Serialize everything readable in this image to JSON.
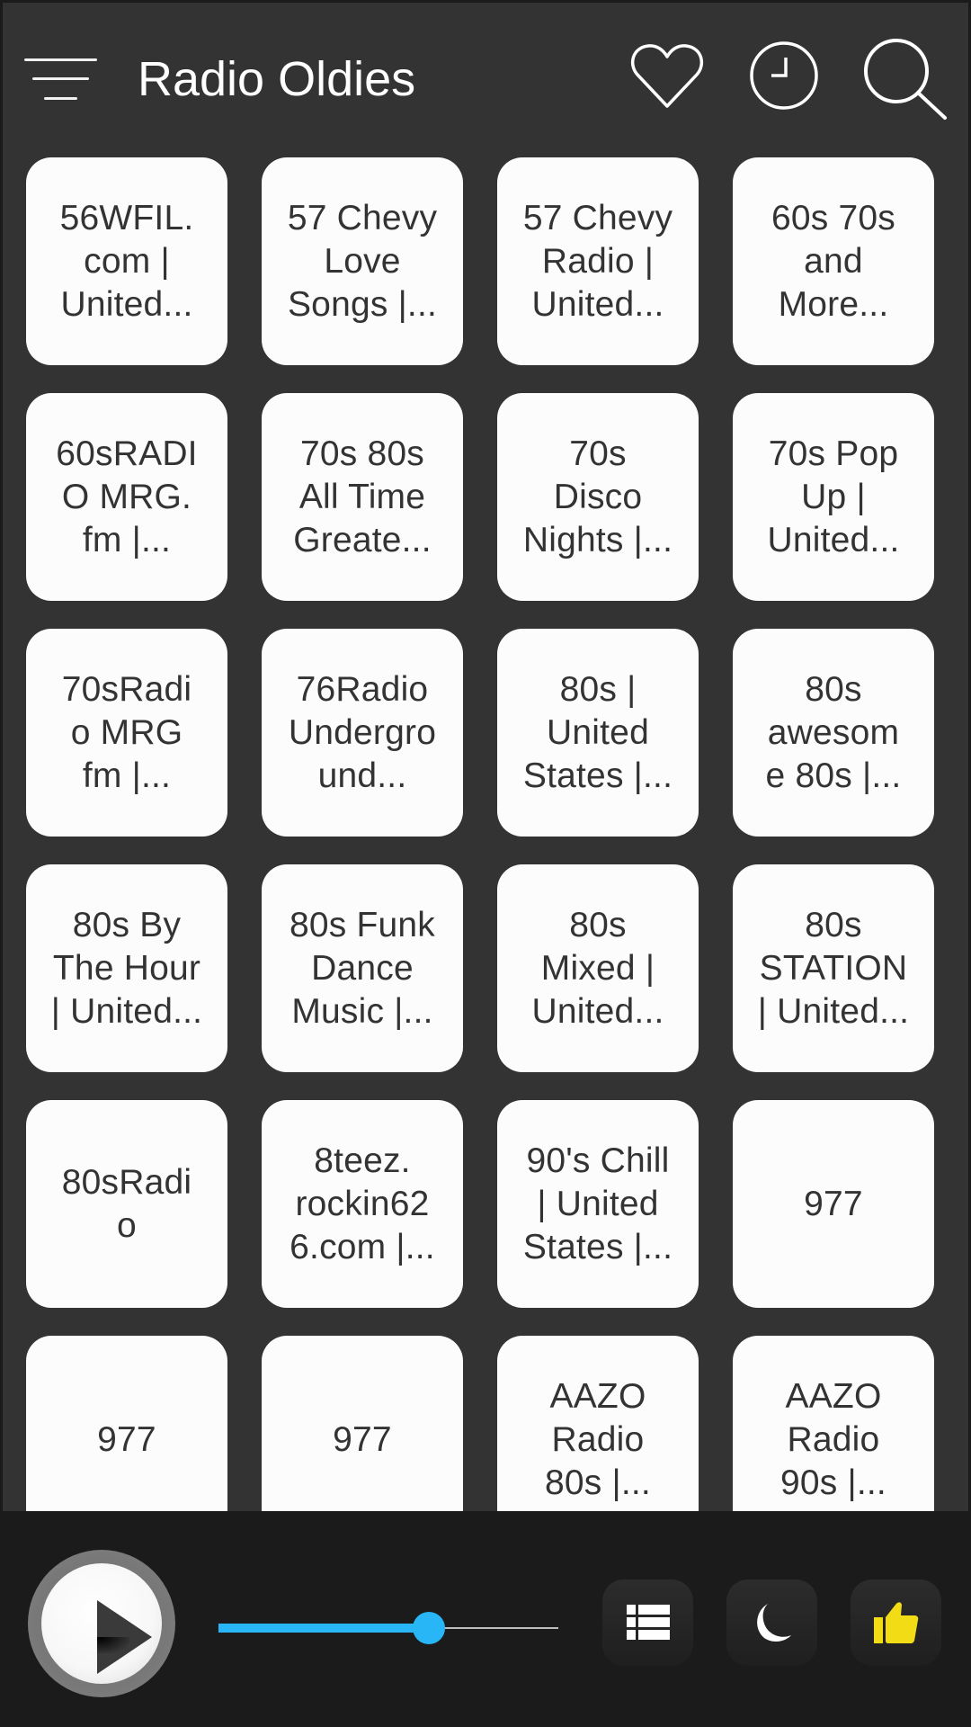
{
  "header": {
    "title": "Radio Oldies",
    "icons": [
      "menu-icon",
      "heart-icon",
      "clock-icon",
      "search-icon"
    ]
  },
  "stations": [
    {
      "label": "56WFIL.\ncom |\nUnited..."
    },
    {
      "label": "57 Chevy\nLove\nSongs |..."
    },
    {
      "label": "57 Chevy\nRadio |\nUnited..."
    },
    {
      "label": "60s 70s\nand\nMore..."
    },
    {
      "label": "60sRADI\nO MRG.\nfm |..."
    },
    {
      "label": "70s 80s\nAll Time\nGreate..."
    },
    {
      "label": "70s\nDisco\nNights |..."
    },
    {
      "label": "70s Pop\nUp |\nUnited..."
    },
    {
      "label": "70sRadi\no MRG\nfm |..."
    },
    {
      "label": "76Radio\nUndergro\nund..."
    },
    {
      "label": "80s |\nUnited\nStates |..."
    },
    {
      "label": "80s\nawesom\ne 80s |..."
    },
    {
      "label": "80s By\nThe Hour\n| United..."
    },
    {
      "label": "80s Funk\nDance\nMusic |..."
    },
    {
      "label": "80s\nMixed |\nUnited..."
    },
    {
      "label": "80s\nSTATION\n| United..."
    },
    {
      "label": "80sRadi\no"
    },
    {
      "label": "8teez.\nrockin62\n6.com |..."
    },
    {
      "label": "90's Chill\n| United\nStates |..."
    },
    {
      "label": "977"
    },
    {
      "label": "977"
    },
    {
      "label": "977"
    },
    {
      "label": "AAZO\nRadio\n80s |..."
    },
    {
      "label": "AAZO\nRadio\n90s |..."
    }
  ],
  "player": {
    "state": "paused",
    "volume_percent": 62,
    "buttons": [
      "list-icon",
      "moon-icon",
      "thumbs-up-icon"
    ]
  },
  "colors": {
    "accent": "#29b6f6",
    "thumbs_up": "#f2dc16",
    "header_bg": "#333333",
    "player_bg": "#1b1b1b"
  }
}
